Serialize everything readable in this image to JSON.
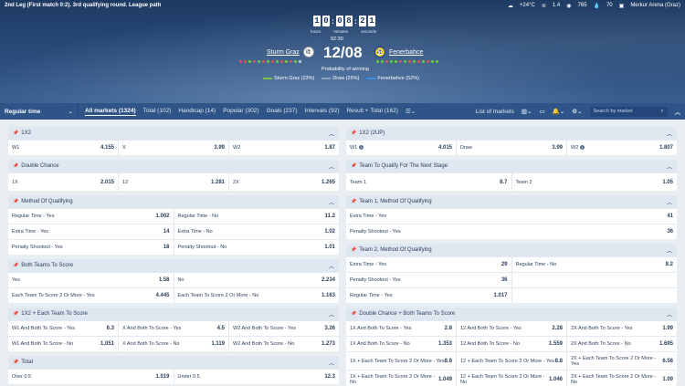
{
  "header": {
    "match_info": "2nd Leg (First match 0:2). 3rd qualifying round. League path",
    "weather": "+24°C",
    "wind": "1.4",
    "pressure": "765",
    "humidity": "70",
    "venue": "Merkur Arena (Graz)"
  },
  "timer": {
    "digits": [
      "1",
      "0",
      "0",
      "8",
      "2",
      "1"
    ],
    "hours_label": "hours",
    "minutes_label": "minutes",
    "seconds_label": "seconds",
    "clock": "02:30"
  },
  "match": {
    "home": "Sturm Graz",
    "away": "Fenerbahce",
    "date": "12/08",
    "prob_title": "Probability of winning",
    "home_prob": "Sturm Graz (23%)",
    "draw_prob": "Draw (25%)",
    "away_prob": "Fenerbahce (52%)",
    "colors": {
      "home": "#7cc242",
      "draw": "#8aa2bf",
      "away": "#3f8fe6",
      "form_win": "#6ccf3b",
      "form_loss": "#e35252",
      "form_draw": "#c5cfdb"
    }
  },
  "nav": {
    "select": "Regular time",
    "tabs": [
      "All markets (1324)",
      "Total (102)",
      "Handicap (14)",
      "Popular (302)",
      "Goals (237)",
      "Intervals (92)",
      "Result + Total (162)"
    ],
    "list_of_markets": "List of markets",
    "search_placeholder": "Search by market"
  },
  "left": [
    {
      "title": "1X2",
      "rows": [
        [
          [
            "W1",
            "4.155"
          ],
          [
            "X",
            "3.99"
          ],
          [
            "W2",
            "1.87"
          ]
        ]
      ]
    },
    {
      "title": "Double Chance",
      "rows": [
        [
          [
            "1X",
            "2.015"
          ],
          [
            "12",
            "1.281"
          ],
          [
            "2X",
            "1.265"
          ]
        ]
      ]
    },
    {
      "title": "Method Of Qualifying",
      "rows": [
        [
          [
            "Regular Time - Yes",
            "1.002"
          ],
          [
            "Regular Time - No",
            "11.2"
          ]
        ],
        [
          [
            "Extra Time - Yes",
            "14"
          ],
          [
            "Extra Time - No",
            "1.02"
          ]
        ],
        [
          [
            "Penalty Shootout - Yes",
            "18"
          ],
          [
            "Penalty Shootout - No",
            "1.01"
          ]
        ]
      ]
    },
    {
      "title": "Both Teams To Score",
      "rows": [
        [
          [
            "Yes",
            "1.58"
          ],
          [
            "No",
            "2.234"
          ]
        ],
        [
          [
            "Each Team To Score 2 Or More - Yes",
            "4.445"
          ],
          [
            "Each Team To Score 2 Or More - No",
            "1.163"
          ]
        ]
      ]
    },
    {
      "title": "1X2 + Each Team To Score",
      "rows": [
        [
          [
            "W1 And Both To Score - Yes",
            "6.3"
          ],
          [
            "X And Both To Score - Yes",
            "4.5"
          ],
          [
            "W2 And Both To Score - Yes",
            "3.26"
          ]
        ],
        [
          [
            "W1 And Both To Score - No",
            "1.051"
          ],
          [
            "X And Both To Score - No",
            "1.119"
          ],
          [
            "W2 And Both To Score - No",
            "1.273"
          ]
        ]
      ]
    },
    {
      "title": "Total",
      "rows": [
        [
          [
            "Over 0.5",
            "1.019"
          ],
          [
            "Under 0.5",
            "12.3"
          ]
        ]
      ]
    }
  ],
  "right": [
    {
      "title": "1X2 (2UP)",
      "rows": [
        [
          [
            "W1",
            "4.015"
          ],
          [
            "Draw",
            "3.99"
          ],
          [
            "W2",
            "1.807"
          ]
        ]
      ]
    },
    {
      "title": "Team To Qualify For The Next Stage",
      "rows": [
        [
          [
            "Team 1",
            "8.7"
          ],
          [
            "Team 2",
            "1.05"
          ]
        ]
      ]
    },
    {
      "title": "Team 1, Method Of Qualifying",
      "rows": [
        [
          [
            "Extra Time - Yes",
            "41"
          ]
        ],
        [
          [
            "Penalty Shootout - Yes",
            "36"
          ]
        ]
      ]
    },
    {
      "title": "Team 2, Method Of Qualifying",
      "rows": [
        [
          [
            "Extra Time - Yes",
            "29"
          ],
          [
            "Regular Time - No",
            "8.2"
          ]
        ],
        [
          [
            "Penalty Shootout - Yes",
            "36"
          ],
          [
            "",
            ""
          ]
        ],
        [
          [
            "Regular Time - Yes",
            "1.017"
          ],
          [
            "",
            ""
          ]
        ]
      ]
    },
    {
      "title": "Double Chance + Both Teams To Score",
      "rows": [
        [
          [
            "1X And Both To Score - Yes",
            "2.8"
          ],
          [
            "12 And Both To Score - Yes",
            "2.28"
          ],
          [
            "2X And Both To Score - Yes",
            "1.99"
          ]
        ],
        [
          [
            "1X And Both To Score - No",
            "1.353"
          ],
          [
            "12 And Both To Score - No",
            "1.559"
          ],
          [
            "2X And Both To Score - No",
            "1.695"
          ]
        ],
        [
          [
            "1X + Each Team To Score 2 Or More - Yes",
            "8.6"
          ],
          [
            "12 + Each Team To Score 2 Or More - Yes",
            "8.8"
          ],
          [
            "2X + Each Team To Score 2 Or More - Yes",
            "6.56"
          ]
        ],
        [
          [
            "1X + Each Team To Score 2 Or More - No",
            "1.049"
          ],
          [
            "12 + Each Team To Score 2 Or More - No",
            "1.046"
          ],
          [
            "2X + Each Team To Score 2 Or More - No",
            "1.09"
          ]
        ]
      ]
    }
  ]
}
